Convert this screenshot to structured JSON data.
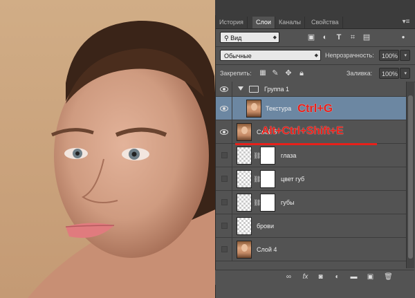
{
  "tabs": [
    {
      "label": "История",
      "active": false
    },
    {
      "label": "Слои",
      "active": true
    },
    {
      "label": "Каналы",
      "active": false
    },
    {
      "label": "Свойства",
      "active": false
    }
  ],
  "filter": {
    "kind_label": "Вид"
  },
  "blend": {
    "mode": "Обычные",
    "opacity_label": "Непрозрачность:",
    "opacity_value": "100%"
  },
  "lock": {
    "label": "Закрепить:",
    "fill_label": "Заливка:",
    "fill_value": "100%"
  },
  "layers": [
    {
      "name": "Группа 1",
      "type": "group",
      "visible": true
    },
    {
      "name": "Текстура",
      "type": "image",
      "visible": true,
      "selected": true
    },
    {
      "name": "Слой 5",
      "type": "image",
      "visible": true
    },
    {
      "name": "глаза",
      "type": "masked",
      "visible": false
    },
    {
      "name": "цвет губ",
      "type": "masked",
      "visible": false
    },
    {
      "name": "губы",
      "type": "masked",
      "visible": false
    },
    {
      "name": "брови",
      "type": "transparent",
      "visible": false
    },
    {
      "name": "Слой 4",
      "type": "image",
      "visible": false
    }
  ],
  "annotations": {
    "ctrl_g": "Ctrl+G",
    "stamp": "Alt+Ctrl+Shift+E"
  },
  "colors": {
    "accent_red": "#e8201a",
    "selected_row": "#6c87a2",
    "panel_bg": "#535353"
  }
}
